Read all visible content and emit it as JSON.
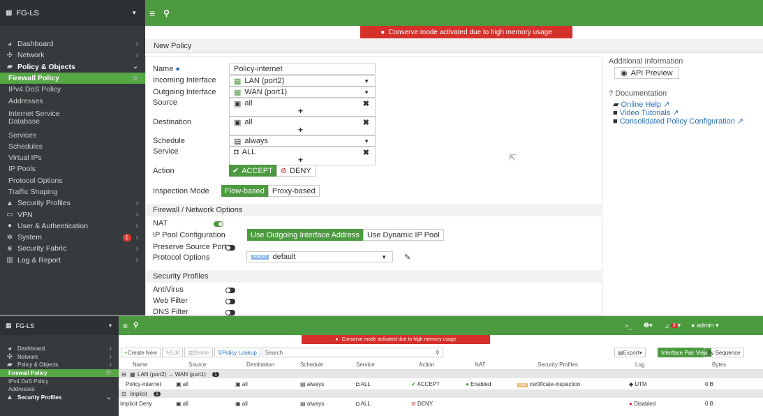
{
  "top": {
    "device": "FG-LS",
    "banner": "Conserve mode activated due to high memory usage",
    "breadcrumb": "New Policy",
    "nav": [
      {
        "label": "Dashboard",
        "icon": "dashboard-icon",
        "glyph": "◕",
        "type": "top",
        "chevron": "›"
      },
      {
        "label": "Network",
        "icon": "network-icon",
        "glyph": "✣",
        "type": "top",
        "chevron": "›"
      },
      {
        "label": "Policy & Objects",
        "icon": "policy-icon",
        "glyph": "▰",
        "type": "bold",
        "chevron": "⌄"
      },
      {
        "label": "Firewall Policy",
        "type": "active",
        "star": "☆"
      },
      {
        "label": "IPv4 DoS Policy",
        "type": "sub"
      },
      {
        "label": "Addresses",
        "type": "sub"
      },
      {
        "label": "Internet Service Database",
        "type": "sub2"
      },
      {
        "label": "Services",
        "type": "sub"
      },
      {
        "label": "Schedules",
        "type": "sub"
      },
      {
        "label": "Virtual IPs",
        "type": "sub"
      },
      {
        "label": "IP Pools",
        "type": "sub"
      },
      {
        "label": "Protocol Options",
        "type": "sub"
      },
      {
        "label": "Traffic Shaping",
        "type": "sub"
      },
      {
        "label": "Security Profiles",
        "icon": "lock-icon",
        "glyph": "▲",
        "type": "top",
        "chevron": "›"
      },
      {
        "label": "VPN",
        "icon": "vpn-icon",
        "glyph": "▭",
        "type": "top",
        "chevron": "›"
      },
      {
        "label": "User & Authentication",
        "icon": "user-icon",
        "glyph": "●",
        "type": "top",
        "chevron": "›"
      },
      {
        "label": "System",
        "icon": "gear-icon",
        "glyph": "✲",
        "type": "top",
        "chevron": "›",
        "badge": "1"
      },
      {
        "label": "Security Fabric",
        "icon": "fabric-icon",
        "glyph": "⋇",
        "type": "top",
        "chevron": "›"
      },
      {
        "label": "Log & Report",
        "icon": "chart-icon",
        "glyph": "▥",
        "type": "top",
        "chevron": "›"
      }
    ],
    "form": {
      "name_label": "Name",
      "name_value": "Policy-internet",
      "incoming_label": "Incoming Interface",
      "incoming_value": "LAN (port2)",
      "outgoing_label": "Outgoing Interface",
      "outgoing_value": "WAN (port1)",
      "source_label": "Source",
      "source_value": "all",
      "destination_label": "Destination",
      "destination_value": "all",
      "schedule_label": "Schedule",
      "schedule_value": "always",
      "service_label": "Service",
      "service_value": "ALL",
      "action_label": "Action",
      "accept": "ACCEPT",
      "deny": "DENY",
      "inspection_label": "Inspection Mode",
      "flow_based": "Flow-based",
      "proxy_based": "Proxy-based",
      "fw_section": "Firewall / Network Options",
      "nat_label": "NAT",
      "ippool_label": "IP Pool Configuration",
      "use_outgoing": "Use Outgoing Interface Address",
      "use_dynamic": "Use Dynamic IP Pool",
      "preserve_label": "Preserve Source Port",
      "protocol_label": "Protocol Options",
      "prot_tag": "PROT",
      "protocol_value": "default",
      "sec_section": "Security Profiles",
      "antivirus": "AntiVirus",
      "webfilter": "Web Filter",
      "dnsfilter": "DNS Filter"
    },
    "right": {
      "title": "Additional Information",
      "api_preview": "API Preview",
      "doc_title": "Documentation",
      "online_help": "Online Help",
      "video_tutorials": "Video Tutorials",
      "consolidated": "Consolidated Policy Configuration"
    }
  },
  "bottom": {
    "device": "FG-LS",
    "banner": "Conserve mode activated due to high memory usage",
    "user": "admin",
    "alert_count": "3",
    "nav": [
      {
        "label": "Dashboard",
        "icon": "dashboard-icon",
        "glyph": "◕",
        "type": "top",
        "chevron": "›"
      },
      {
        "label": "Network",
        "icon": "network-icon",
        "glyph": "✣",
        "type": "top",
        "chevron": "›"
      },
      {
        "label": "Policy & Objects",
        "icon": "policy-icon",
        "glyph": "▰",
        "type": "top",
        "chevron": "›"
      },
      {
        "label": "Firewall Policy",
        "type": "active",
        "star": "☆"
      },
      {
        "label": "IPv4 DoS Policy",
        "type": "sub"
      },
      {
        "label": "Addresses",
        "type": "sub"
      },
      {
        "label": "Security Profiles",
        "icon": "lock-icon",
        "glyph": "▲",
        "type": "bold",
        "chevron": "⌄"
      }
    ],
    "toolbar": {
      "create_new": "Create New",
      "edit": "Edit",
      "delete": "Delete",
      "policy_lookup": "Policy Lookup",
      "search_placeholder": "Search",
      "export": "Export",
      "interface_pair": "Interface Pair View",
      "by_sequence": "By Sequence"
    },
    "columns": [
      "Name",
      "Source",
      "Destination",
      "Schedule",
      "Service",
      "Action",
      "NAT",
      "Security Profiles",
      "Log",
      "Bytes"
    ],
    "group1": "LAN (port2) → WAN (port1)",
    "group1_count": "1",
    "row1": {
      "name": "Policy-internet",
      "source": "all",
      "destination": "all",
      "schedule": "always",
      "service": "ALL",
      "action": "ACCEPT",
      "nat": "Enabled",
      "ssl_tag": "SSL",
      "profiles": "certificate-inspection",
      "log": "UTM",
      "bytes": "0 B"
    },
    "group2": "Implicit",
    "group2_count": "1",
    "row2": {
      "name": "Implicit Deny",
      "source": "all",
      "destination": "all",
      "schedule": "always",
      "service": "ALL",
      "action": "DENY",
      "log": "Disabled",
      "bytes": "0 B"
    }
  }
}
